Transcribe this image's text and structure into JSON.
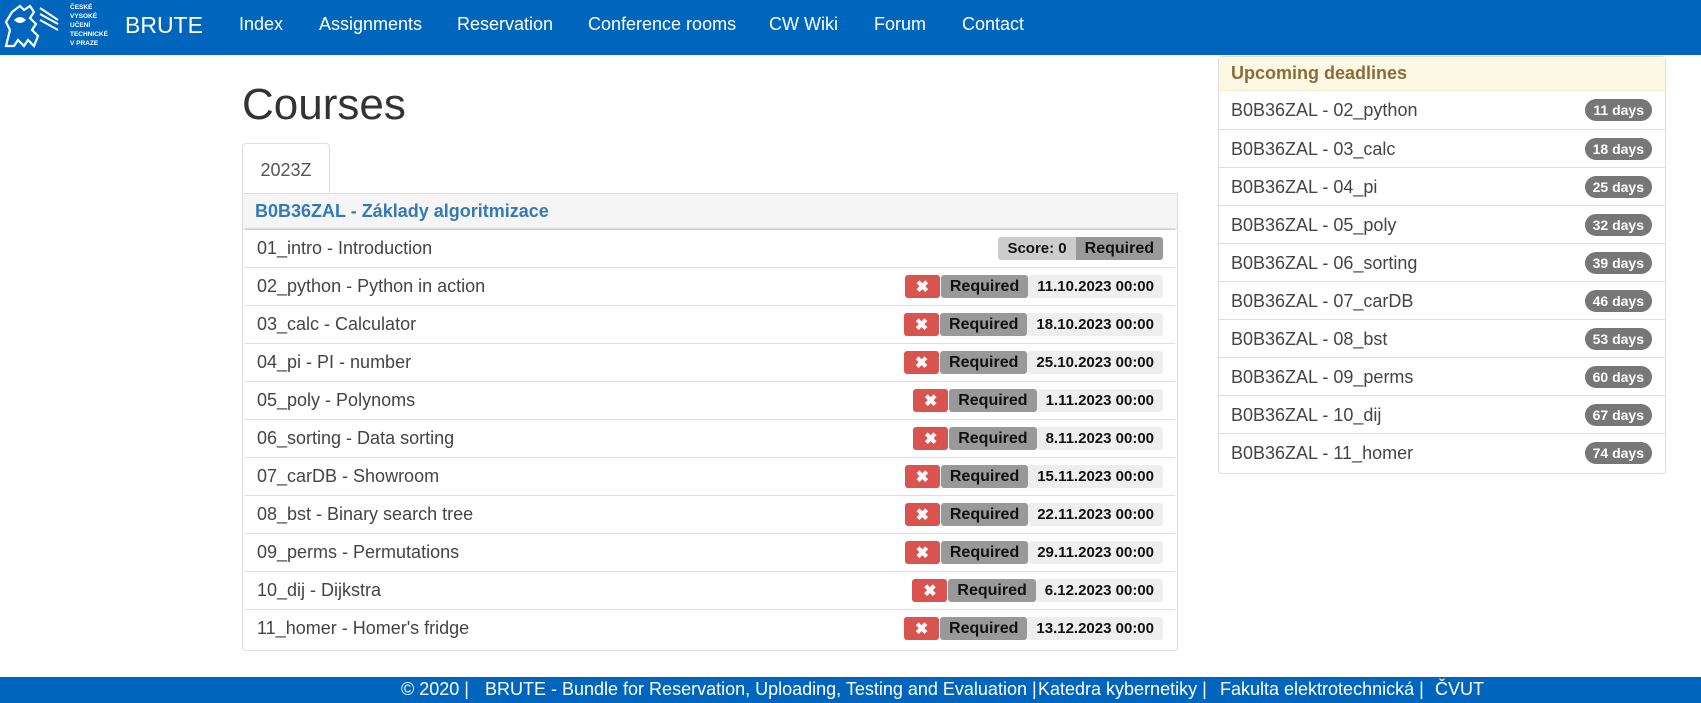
{
  "navbar": {
    "logo_text": [
      "ČESKÉ",
      "VYSOKÉ",
      "UČENÍ",
      "TECHNICKÉ",
      "V PRAZE"
    ],
    "brand": "BRUTE",
    "links": [
      "Index",
      "Assignments",
      "Reservation",
      "Conference rooms",
      "CW Wiki",
      "Forum",
      "Contact"
    ]
  },
  "main": {
    "title": "Courses",
    "tab": "2023Z",
    "course": {
      "code": "B0B36ZAL",
      "name": "Základy algoritmizace",
      "heading": "B0B36ZAL - Základy algoritmizace",
      "first_row": {
        "label": "01_intro - Introduction",
        "score": "Score: 0",
        "required": "Required"
      },
      "assignments": [
        {
          "label": "02_python - Python in action",
          "status": "✖",
          "required": "Required",
          "deadline": "11.10.2023 00:00"
        },
        {
          "label": "03_calc - Calculator",
          "status": "✖",
          "required": "Required",
          "deadline": "18.10.2023 00:00"
        },
        {
          "label": "04_pi - PI - number",
          "status": "✖",
          "required": "Required",
          "deadline": "25.10.2023 00:00"
        },
        {
          "label": "05_poly - Polynoms",
          "status": "✖",
          "required": "Required",
          "deadline": "1.11.2023 00:00"
        },
        {
          "label": "06_sorting - Data sorting",
          "status": "✖",
          "required": "Required",
          "deadline": "8.11.2023 00:00"
        },
        {
          "label": "07_carDB - Showroom",
          "status": "✖",
          "required": "Required",
          "deadline": "15.11.2023 00:00"
        },
        {
          "label": "08_bst - Binary search tree",
          "status": "✖",
          "required": "Required",
          "deadline": "22.11.2023 00:00"
        },
        {
          "label": "09_perms - Permutations",
          "status": "✖",
          "required": "Required",
          "deadline": "29.11.2023 00:00"
        },
        {
          "label": "10_dij - Dijkstra",
          "status": "✖",
          "required": "Required",
          "deadline": "6.12.2023 00:00"
        },
        {
          "label": "11_homer - Homer's fridge",
          "status": "✖",
          "required": "Required",
          "deadline": "13.12.2023 00:00"
        }
      ]
    }
  },
  "deadlines": {
    "heading": "Upcoming deadlines",
    "items": [
      {
        "label": "B0B36ZAL - 02_python",
        "days": "11 days"
      },
      {
        "label": "B0B36ZAL - 03_calc",
        "days": "18 days"
      },
      {
        "label": "B0B36ZAL - 04_pi",
        "days": "25 days"
      },
      {
        "label": "B0B36ZAL - 05_poly",
        "days": "32 days"
      },
      {
        "label": "B0B36ZAL - 06_sorting",
        "days": "39 days"
      },
      {
        "label": "B0B36ZAL - 07_carDB",
        "days": "46 days"
      },
      {
        "label": "B0B36ZAL - 08_bst",
        "days": "53 days"
      },
      {
        "label": "B0B36ZAL - 09_perms",
        "days": "60 days"
      },
      {
        "label": "B0B36ZAL - 10_dij",
        "days": "67 days"
      },
      {
        "label": "B0B36ZAL - 11_homer",
        "days": "74 days"
      }
    ]
  },
  "footer": {
    "copyright": "© 2020 |",
    "brute": "BRUTE - Bundle for Reservation, Uploading, Testing and Evaluation |",
    "dept": "Katedra kybernetiky |",
    "faculty": "Fakulta elektrotechnická |",
    "univ": "ČVUT"
  },
  "colors": {
    "nav_bg": "#0065bd",
    "danger": "#d9534f",
    "link": "#337ab7",
    "badge": "#777777"
  }
}
